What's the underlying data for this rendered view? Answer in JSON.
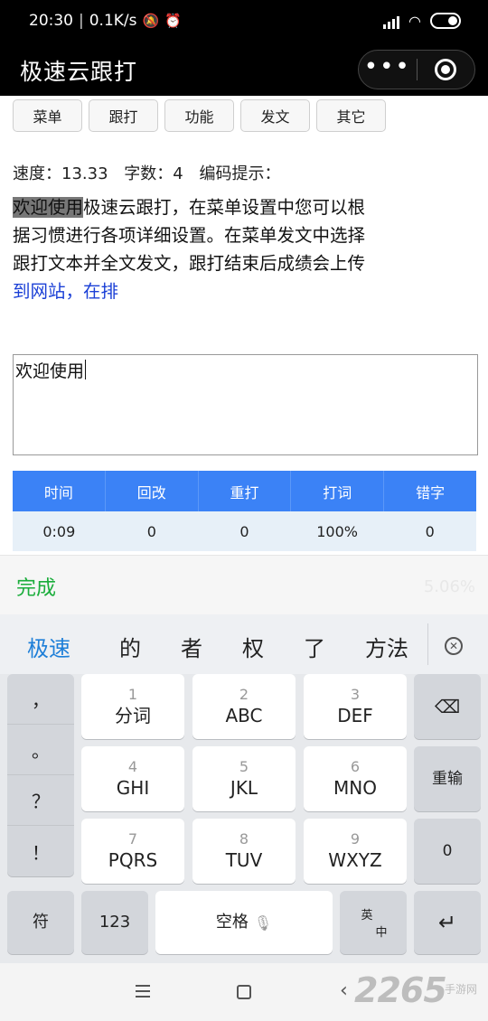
{
  "status_bar": {
    "time": "20:30",
    "net_speed": "0.1K/s",
    "icons": [
      "mute-bell-icon",
      "alarm-icon",
      "signal-icon",
      "wifi-icon",
      "battery-icon"
    ]
  },
  "title_bar": {
    "title": "极速云跟打",
    "more_icon": "•••",
    "close_icon": "target-circle-icon"
  },
  "menu": [
    "菜单",
    "跟打",
    "功能",
    "发文",
    "其它"
  ],
  "stats": {
    "speed": "速度：13.33",
    "count": "字数：4",
    "hint": "编码提示："
  },
  "reference": {
    "typed": "欢迎使用",
    "pending": "极速云跟打，在菜单设置中您可以根据习惯进行各项详细设置。在菜单发文中选择跟打文本并全文发文，跟打结束后成绩会上传",
    "upcoming": "到网站，在排"
  },
  "input": {
    "value": "欢迎使用"
  },
  "score": {
    "headers": [
      "时间",
      "回改",
      "重打",
      "打词",
      "错字"
    ],
    "values": [
      "0:09",
      "0",
      "0",
      "100%",
      "0"
    ]
  },
  "keyboard": {
    "done": "完成",
    "faint_percent": "5.06%",
    "candidates": [
      "极速",
      "的",
      "者",
      "权",
      "了",
      "方法"
    ],
    "punctuation": [
      "，",
      "。",
      "？",
      "！"
    ],
    "keys": [
      {
        "num": "1",
        "label": "分词"
      },
      {
        "num": "2",
        "label": "ABC"
      },
      {
        "num": "3",
        "label": "DEF"
      },
      {
        "num": "4",
        "label": "GHI"
      },
      {
        "num": "5",
        "label": "JKL"
      },
      {
        "num": "6",
        "label": "MNO"
      },
      {
        "num": "7",
        "label": "PQRS"
      },
      {
        "num": "8",
        "label": "TUV"
      },
      {
        "num": "9",
        "label": "WXYZ"
      }
    ],
    "reenter": "重输",
    "zero": "0",
    "symbol": "符",
    "numbers": "123",
    "space": "空格",
    "lang_top": "英",
    "lang_bottom": "中",
    "enter_icon": "↵",
    "backspace_icon": "⌫"
  },
  "watermark": {
    "brand": "2265",
    "sub": "手游网"
  }
}
